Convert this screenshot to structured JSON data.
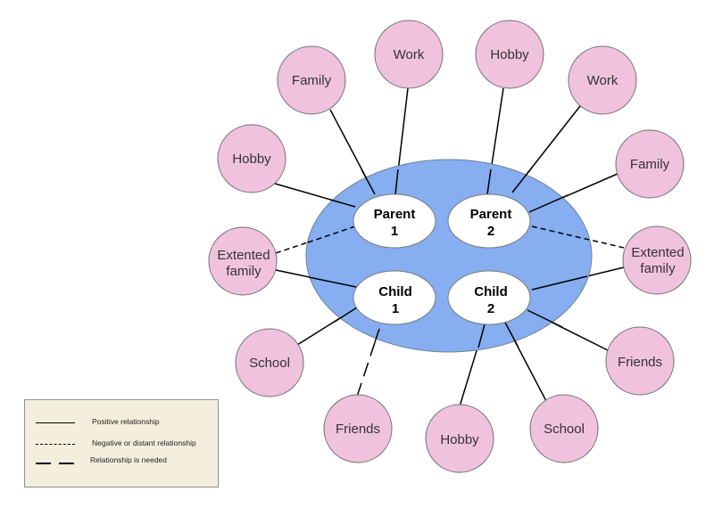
{
  "diagram": {
    "type": "family-ecomap",
    "colors": {
      "family_system_fill": "#86aef0",
      "member_fill": "#ffffff",
      "external_fill": "#f0c2de",
      "line": "#000000",
      "legend_bg": "#f3efdc"
    },
    "members": [
      {
        "id": "parent1",
        "line1": "Parent",
        "line2": "1"
      },
      {
        "id": "parent2",
        "line1": "Parent",
        "line2": "2"
      },
      {
        "id": "child1",
        "line1": "Child",
        "line2": "1"
      },
      {
        "id": "child2",
        "line1": "Child",
        "line2": "2"
      }
    ],
    "external_nodes": [
      {
        "id": "p1-hobby",
        "label": "Hobby",
        "member": "parent1",
        "relationship": "positive"
      },
      {
        "id": "p1-family",
        "label": "Family",
        "member": "parent1",
        "relationship": "positive"
      },
      {
        "id": "p1-work",
        "label": "Work",
        "member": "parent1",
        "relationship": "positive"
      },
      {
        "id": "p2-hobby",
        "label": "Hobby",
        "member": "parent2",
        "relationship": "positive"
      },
      {
        "id": "p2-work",
        "label": "Work",
        "member": "parent2",
        "relationship": "positive"
      },
      {
        "id": "p2-family",
        "label": "Family",
        "member": "parent2",
        "relationship": "positive"
      },
      {
        "id": "ext-family-left",
        "line1": "Extented",
        "line2": "family",
        "connections": [
          {
            "member": "parent1",
            "relationship": "negative"
          },
          {
            "member": "child1",
            "relationship": "positive"
          }
        ]
      },
      {
        "id": "ext-family-right",
        "line1": "Extented",
        "line2": "family",
        "connections": [
          {
            "member": "parent2",
            "relationship": "negative"
          },
          {
            "member": "child2",
            "relationship": "positive"
          }
        ]
      },
      {
        "id": "c1-school",
        "label": "School",
        "member": "child1",
        "relationship": "positive"
      },
      {
        "id": "c1-friends",
        "label": "Friends",
        "member": "child1",
        "relationship": "needed"
      },
      {
        "id": "c2-hobby",
        "label": "Hobby",
        "member": "child2",
        "relationship": "positive"
      },
      {
        "id": "c2-school",
        "label": "School",
        "member": "child2",
        "relationship": "positive"
      },
      {
        "id": "c2-friends",
        "label": "Friends",
        "member": "child2",
        "relationship": "positive"
      }
    ]
  },
  "legend": {
    "items": [
      {
        "style": "solid",
        "label": "Positive relationship"
      },
      {
        "style": "dashed",
        "label": "Negative or distant relationship"
      },
      {
        "style": "long-dash",
        "label": "Relationship is needed"
      }
    ]
  }
}
